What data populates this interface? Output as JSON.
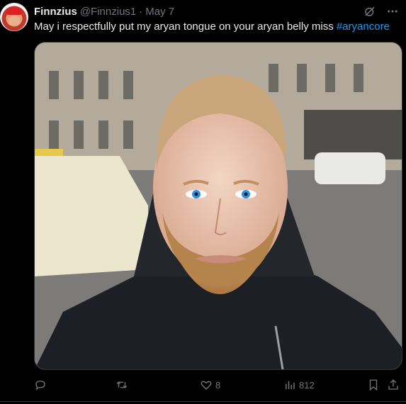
{
  "tweet": {
    "author": {
      "name": "Finnzius",
      "handle": "@Finnzius1",
      "separator": "·",
      "date": "May 7"
    },
    "text_main": "May i respectfully put my aryan tongue on your aryan belly miss ",
    "hashtag": "#aryancore",
    "header_icons": [
      "grok-icon",
      "more-icon"
    ],
    "actions": {
      "reply": {
        "icon": "reply-icon",
        "count": ""
      },
      "retweet": {
        "icon": "retweet-icon",
        "count": ""
      },
      "like": {
        "icon": "heart-icon",
        "count": "8"
      },
      "views": {
        "icon": "views-icon",
        "count": "812"
      },
      "bookmark": {
        "icon": "bookmark-icon"
      },
      "share": {
        "icon": "share-icon"
      }
    },
    "colors": {
      "background": "#000000",
      "text": "#e7e9ea",
      "muted": "#71767b",
      "link": "#1d9bf0",
      "border": "#2f3336"
    }
  }
}
